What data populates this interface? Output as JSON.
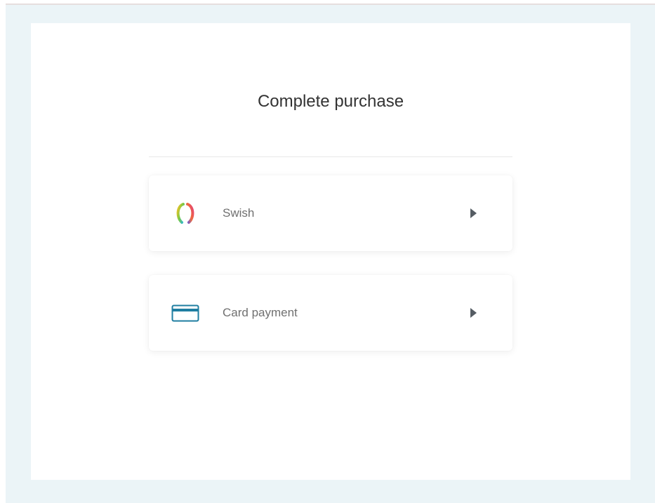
{
  "page": {
    "title": "Complete purchase"
  },
  "payment_options": [
    {
      "label": "Swish",
      "icon": "swish-logo-icon",
      "arrow_icon": "chevron-right-icon"
    },
    {
      "label": "Card payment",
      "icon": "credit-card-icon",
      "arrow_icon": "chevron-right-icon"
    }
  ],
  "colors": {
    "background": "#ebf4f7",
    "panel": "#ffffff",
    "title_text": "#333333",
    "label_text": "#707070",
    "card_icon": "#1f7ea1",
    "arrow": "#555c63"
  }
}
